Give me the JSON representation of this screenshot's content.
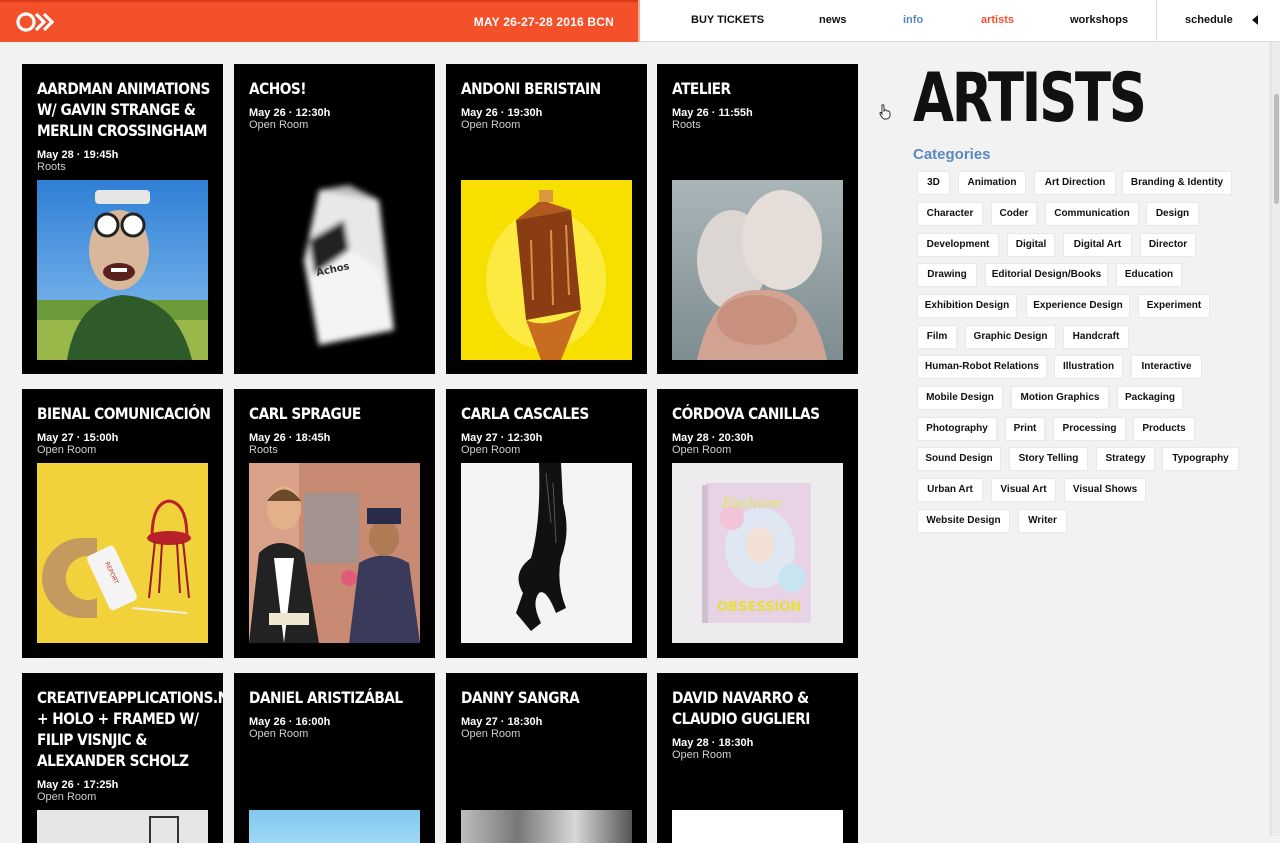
{
  "header": {
    "dates": "MAY 26-27-28 2016 BCN",
    "nav": {
      "buy_tickets": "BUY TICKETS",
      "news": "news",
      "info": "info",
      "artists": "artists",
      "workshops": "workshops",
      "schedule": "schedule"
    },
    "colors": {
      "brand": "#f4502a",
      "info": "#5b88c0",
      "artists": "#f4502a"
    }
  },
  "page": {
    "title": "ARTISTS",
    "categories_heading": "Categories",
    "categories": [
      "3D",
      "Animation",
      "Art Direction",
      "Branding & Identity",
      "Character",
      "Coder",
      "Communication",
      "Design",
      "Development",
      "Digital",
      "Digital Art",
      "Director",
      "Drawing",
      "Editorial Design/Books",
      "Education",
      "Exhibition Design",
      "Experience Design",
      "Experiment",
      "Film",
      "Graphic Design",
      "Handcraft",
      "Human-Robot Relations",
      "Illustration",
      "Interactive",
      "Mobile Design",
      "Motion Graphics",
      "Packaging",
      "Photography",
      "Print",
      "Processing",
      "Products",
      "Sound Design",
      "Story Telling",
      "Strategy",
      "Typography",
      "Urban Art",
      "Visual Art",
      "Visual Shows",
      "Website Design",
      "Writer"
    ]
  },
  "artists": [
    {
      "name": "AARDMAN ANIMATIONS W/ GAVIN STRANGE & MERLIN CROSSINGHAM",
      "date": "May 28 · 19:45h",
      "room": "Roots"
    },
    {
      "name": "ACHOS!",
      "date": "May 26 · 12:30h",
      "room": "Open Room"
    },
    {
      "name": "ANDONI BERISTAIN",
      "date": "May 26 · 19:30h",
      "room": "Open Room"
    },
    {
      "name": "ATELIER",
      "date": "May 26 · 11:55h",
      "room": "Roots"
    },
    {
      "name": "BIENAL COMUNICACIÓN",
      "date": "May 27 · 15:00h",
      "room": "Open Room"
    },
    {
      "name": "CARL SPRAGUE",
      "date": "May 26 · 18:45h",
      "room": "Roots"
    },
    {
      "name": "CARLA CASCALES",
      "date": "May 27 · 12:30h",
      "room": "Open Room"
    },
    {
      "name": "CÓRDOVA CANILLAS",
      "date": "May 28 · 20:30h",
      "room": "Open Room"
    },
    {
      "name": "CREATIVEAPPLICATIONS.NET + HOLO + FRAMED W/ FILIP VISNJIC & ALEXANDER SCHOLZ",
      "date": "May 26 · 17:25h",
      "room": "Open Room"
    },
    {
      "name": "DANIEL ARISTIZÁBAL",
      "date": "May 26 · 16:00h",
      "room": "Open Room"
    },
    {
      "name": "DANNY SANGRA",
      "date": "May 27 · 18:30h",
      "room": "Open Room"
    },
    {
      "name": "DAVID NAVARRO & CLAUDIO GUGLIERI",
      "date": "May 28 · 18:30h",
      "room": "Open Room"
    }
  ],
  "images": {
    "achos_box": "Achos",
    "bienal_tag": "REPORT",
    "cordova_mag_title": "Fashion",
    "cordova_mag_sub": "OBSESSION"
  }
}
